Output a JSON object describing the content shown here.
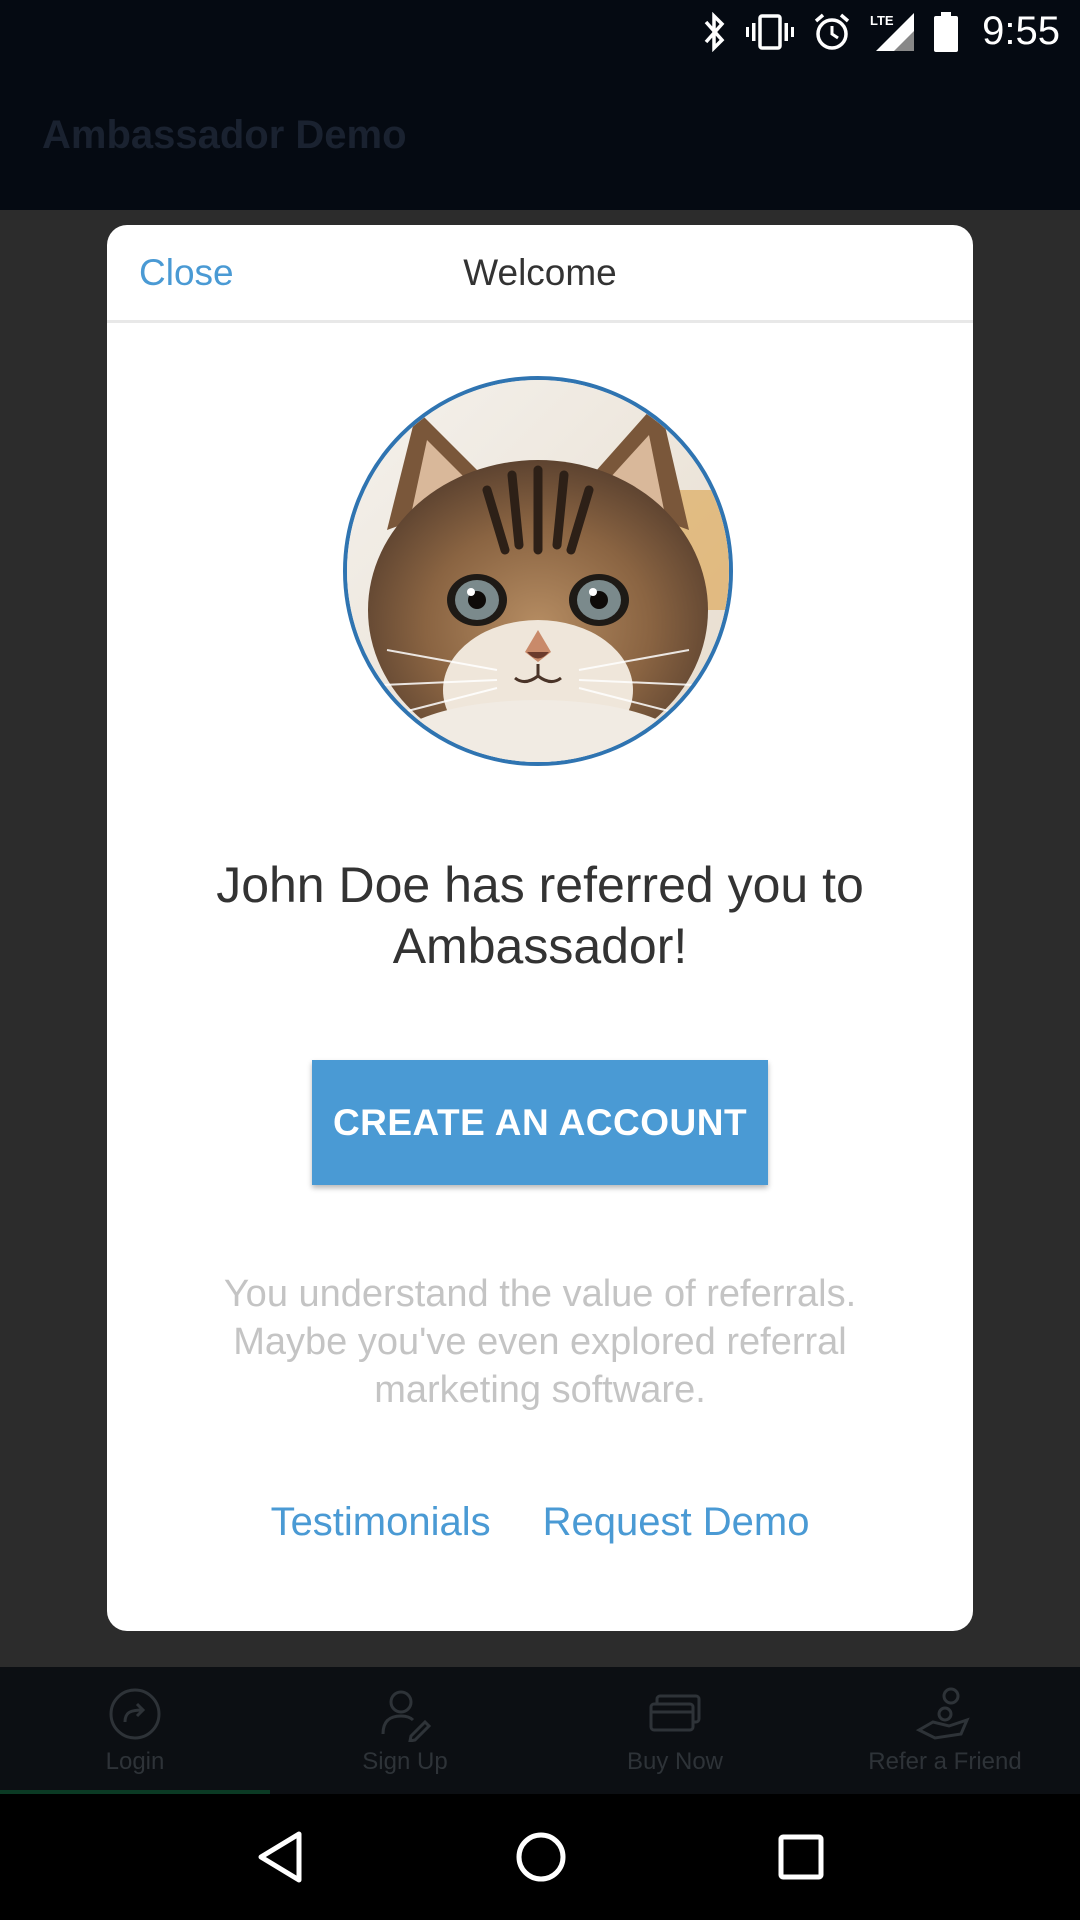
{
  "status_bar": {
    "time": "9:55",
    "icons": [
      "bluetooth-icon",
      "vibrate-icon",
      "alarm-icon",
      "lte-signal-icon",
      "battery-icon"
    ],
    "lte_label": "LTE"
  },
  "app_bar": {
    "title": "Ambassador Demo"
  },
  "modal": {
    "close_label": "Close",
    "title": "Welcome",
    "avatar_alt": "kitten photo",
    "referral_text": "John Doe has referred you to Ambassador!",
    "cta_label": "CREATE AN ACCOUNT",
    "description": "You understand the value of referrals. Maybe you've even explored referral marketing software.",
    "links": [
      "Testimonials",
      "Request Demo"
    ]
  },
  "tab_bar": {
    "tabs": [
      {
        "label": "Login",
        "icon": "login-icon"
      },
      {
        "label": "Sign Up",
        "icon": "sign-up-icon"
      },
      {
        "label": "Buy Now",
        "icon": "credit-card-icon"
      },
      {
        "label": "Refer a Friend",
        "icon": "refer-icon"
      }
    ]
  },
  "colors": {
    "accent": "#4a9ad4",
    "status_bar": "#050a12",
    "dim_overlay": "#2c2c2c"
  }
}
